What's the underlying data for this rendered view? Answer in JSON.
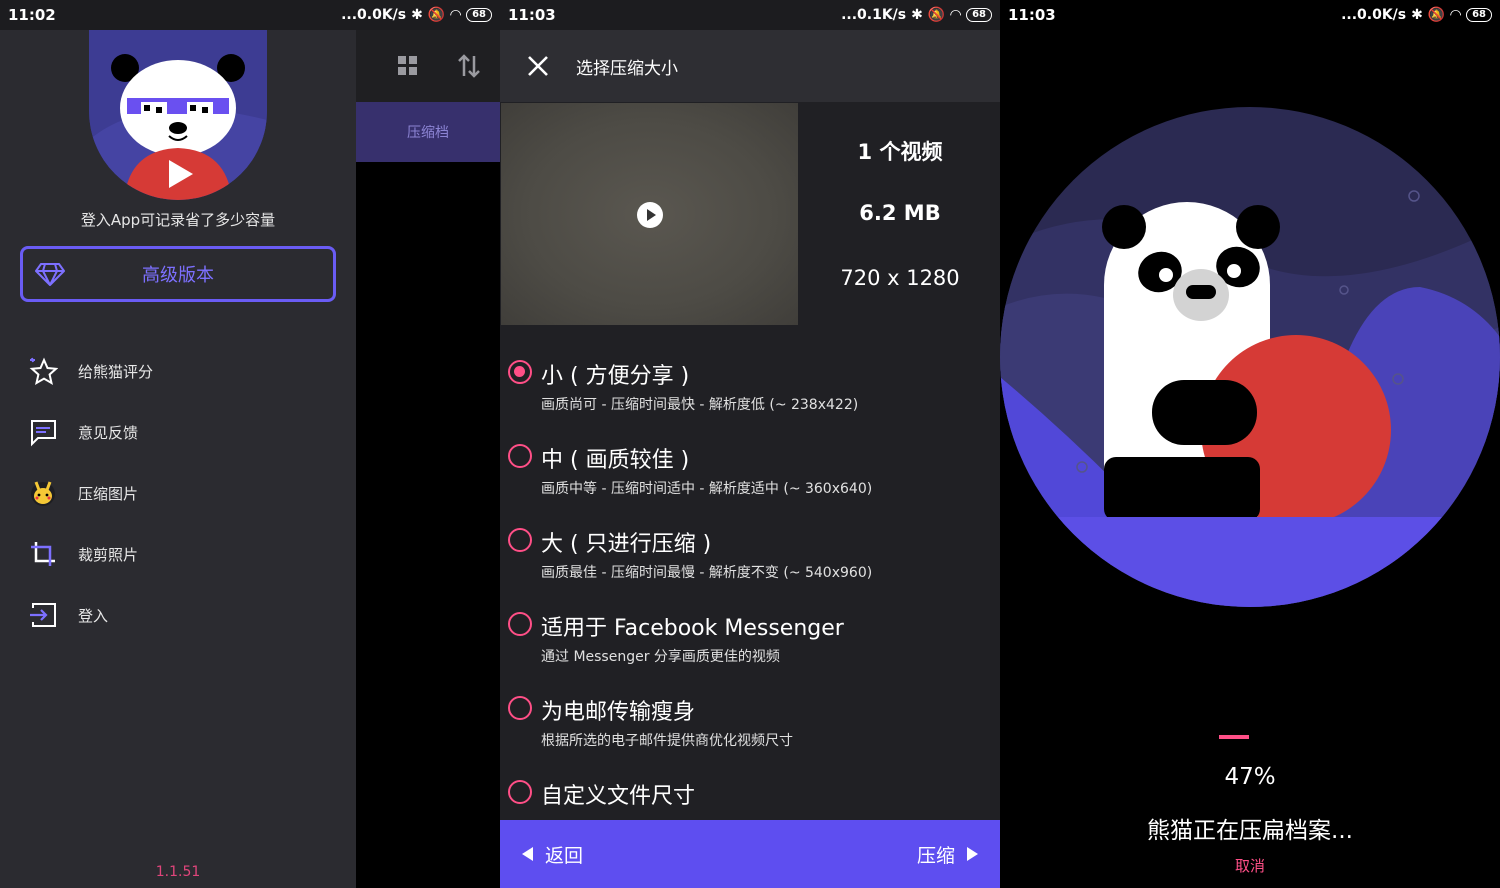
{
  "screen1": {
    "status": {
      "time": "11:02",
      "net": "...0.0K/s",
      "battery": "68"
    },
    "login_hint": "登入App可记录省了多少容量",
    "premium_label": "高级版本",
    "menu": [
      {
        "label": "给熊猫评分",
        "icon": "star-sparkle-icon"
      },
      {
        "label": "意见反馈",
        "icon": "chat-bubble-icon"
      },
      {
        "label": "压缩图片",
        "icon": "pikachu-icon"
      },
      {
        "label": "裁剪照片",
        "icon": "crop-icon"
      },
      {
        "label": "登入",
        "icon": "login-icon"
      }
    ],
    "version": "1.1.51",
    "behind_tab": "压缩档",
    "colors": {
      "accent": "#6a5cf4",
      "drawer_bg": "#2b2b30",
      "version": "#e0457b"
    }
  },
  "screen2": {
    "status": {
      "time": "11:03",
      "net": "...0.1K/s",
      "battery": "68"
    },
    "title": "选择压缩大小",
    "video_count": "1 个视频",
    "video_size": "6.2 MB",
    "video_resolution": "720 x 1280",
    "selected_index": 0,
    "options": [
      {
        "title": "小 ( 方便分享 )",
        "desc": "画质尚可 - 压缩时间最快 - 解析度低 (~ 238x422)"
      },
      {
        "title": "中 ( 画质较佳 )",
        "desc": "画质中等 - 压缩时间适中 - 解析度适中 (~ 360x640)"
      },
      {
        "title": "大 ( 只进行压缩 )",
        "desc": "画质最佳 - 压缩时间最慢 - 解析度不变 (~ 540x960)"
      },
      {
        "title": "适用于 Facebook Messenger",
        "desc": "通过 Messenger 分享画质更佳的视频"
      },
      {
        "title": "为电邮传输瘦身",
        "desc": "根据所选的电子邮件提供商优化视频尺寸"
      },
      {
        "title": "自定义文件尺寸",
        "desc": ""
      }
    ],
    "back_label": "返回",
    "compress_label": "压缩",
    "colors": {
      "radio": "#ff4f87",
      "bottom_bar": "#5e4ef0"
    }
  },
  "screen3": {
    "status": {
      "time": "11:03",
      "net": "...0.0K/s",
      "battery": "68"
    },
    "progress": 47,
    "progress_text": "47%",
    "message": "熊猫正在压扁档案...",
    "cancel_label": "取消"
  }
}
